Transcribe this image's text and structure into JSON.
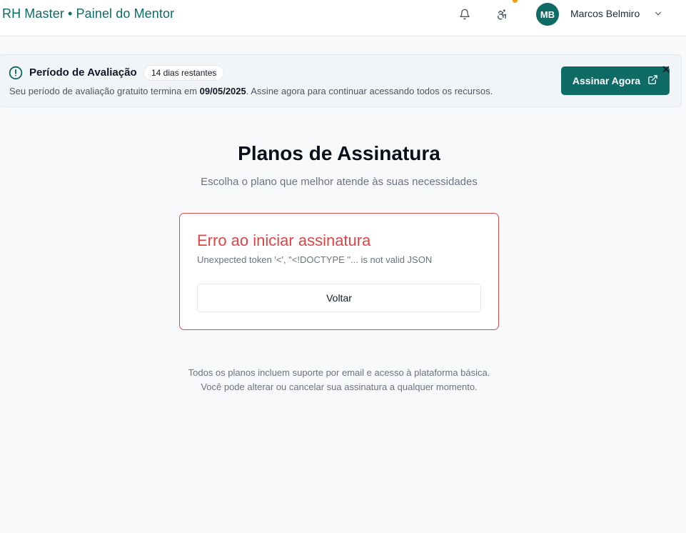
{
  "header": {
    "brand": "RH Master • Painel do Mentor",
    "bell_icon": "bell-icon",
    "accessibility_icon": "accessibility-icon",
    "user": {
      "initials": "MB",
      "name": "Marcos Belmiro"
    },
    "colors": {
      "brand": "#0f6b66",
      "notification_dot": "#f59e0b"
    }
  },
  "trial_banner": {
    "title": "Período de Avaliação",
    "badge": "14 dias restantes",
    "text_before": "Seu período de avaliação gratuito termina em ",
    "date": "09/05/2025",
    "text_after": ". Assine agora para continuar acessando todos os recursos.",
    "button_label": "Assinar Agora",
    "close_icon": "close-icon"
  },
  "main": {
    "title": "Planos de Assinatura",
    "subtitle": "Escolha o plano que melhor atende às suas necessidades",
    "error": {
      "title": "Erro ao iniciar assinatura",
      "message": "Unexpected token '<', \"<!DOCTYPE \"... is not valid JSON",
      "back_button": "Voltar",
      "color": "#e04444"
    },
    "footnote_line1": "Todos os planos incluem suporte por email e acesso à plataforma básica.",
    "footnote_line2": "Você pode alterar ou cancelar sua assinatura a qualquer momento."
  }
}
